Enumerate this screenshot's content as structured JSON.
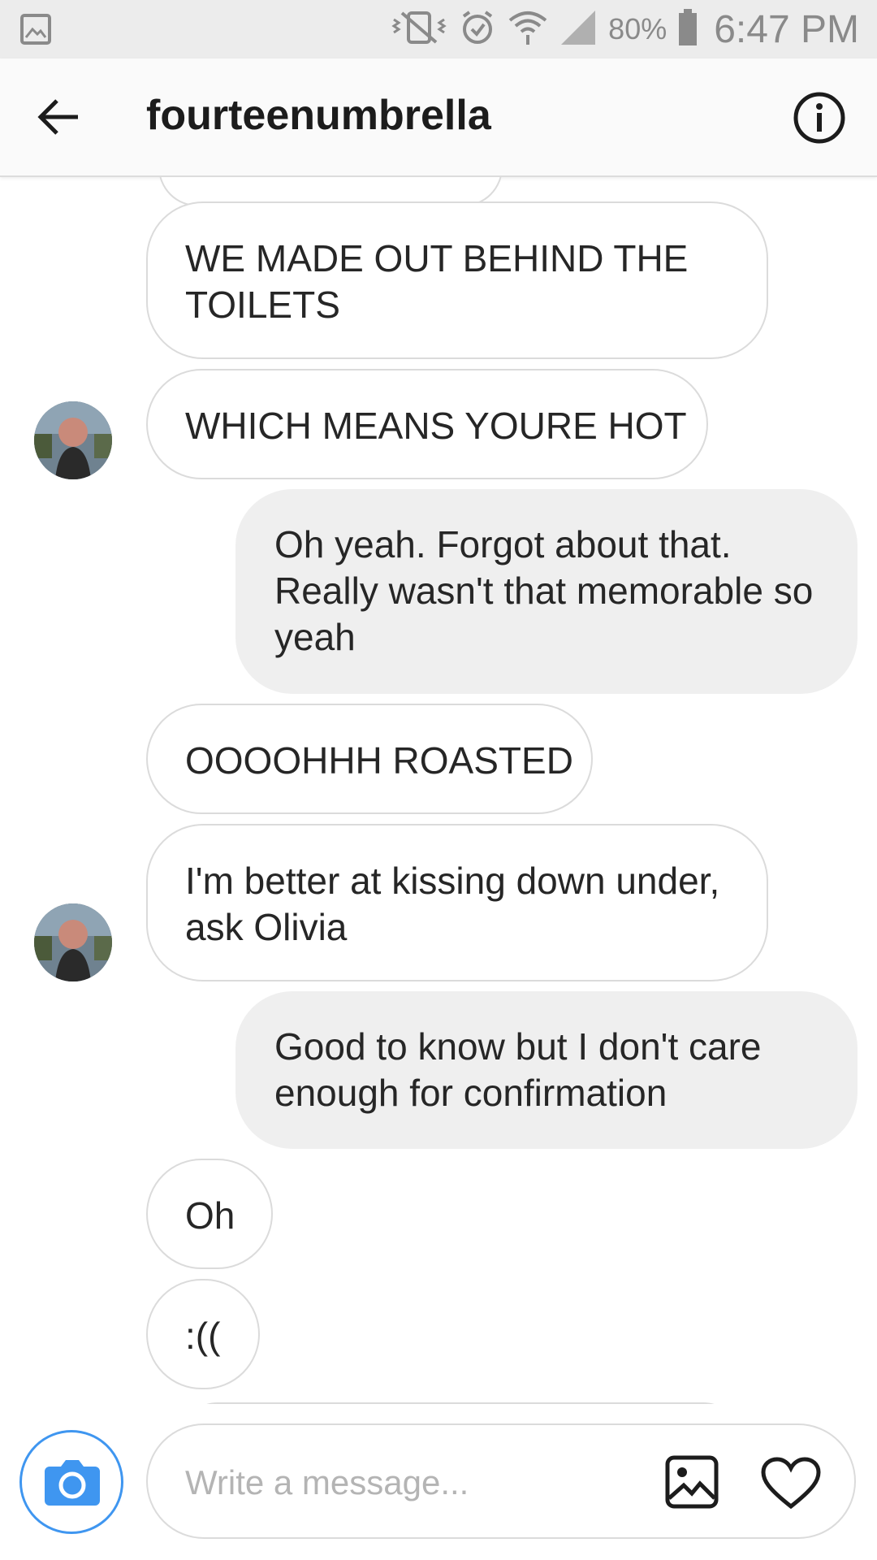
{
  "status_bar": {
    "battery": "80%",
    "time": "6:47 PM"
  },
  "header": {
    "username": "fourteenumbrella"
  },
  "messages": [
    {
      "from": "them",
      "text": "WE MADE OUT BEHIND THE TOILETS"
    },
    {
      "from": "them",
      "text": "WHICH MEANS YOURE HOT"
    },
    {
      "from": "me",
      "text": "Oh yeah. Forgot about that. Really wasn't that memorable so yeah"
    },
    {
      "from": "them",
      "text": "OOOOHHH ROASTED"
    },
    {
      "from": "them",
      "text": "I'm better at kissing down under, ask Olivia"
    },
    {
      "from": "me",
      "text": "Good to know but I don't care enough for confirmation"
    },
    {
      "from": "them",
      "text": "Oh"
    },
    {
      "from": "them",
      "text": ":(("
    }
  ],
  "composer": {
    "placeholder": "Write a message..."
  },
  "colors": {
    "accent": "#3f96f0",
    "sent_bubble": "#efefef",
    "received_border": "#dbdbdb"
  }
}
